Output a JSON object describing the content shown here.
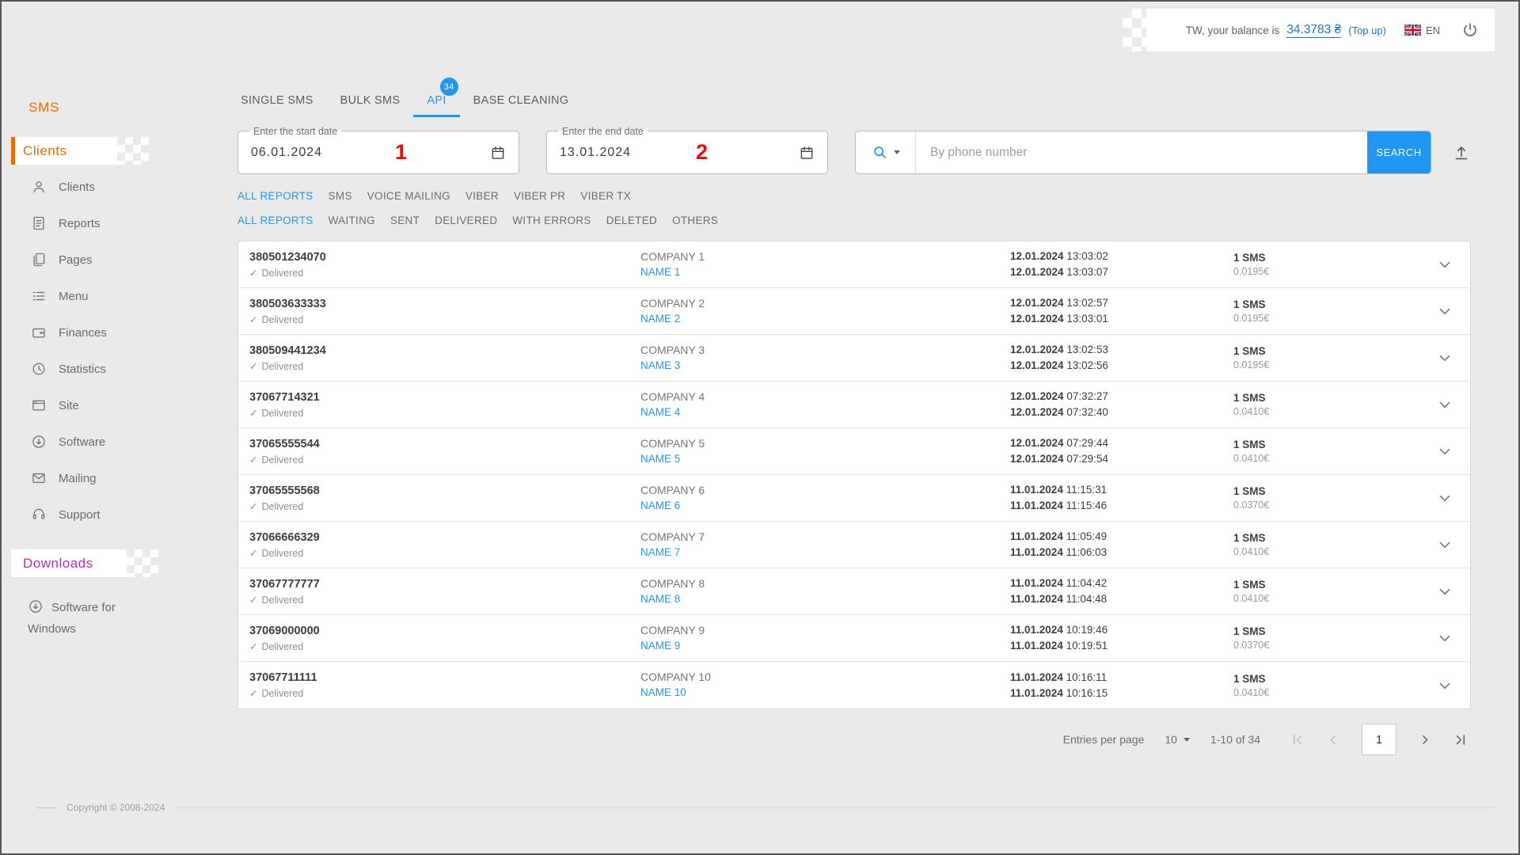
{
  "topbar": {
    "balance_prefix": "TW, your balance is",
    "balance_amount": "34.3783 ₴",
    "topup": "(Top up)",
    "language": "EN"
  },
  "sidebar": {
    "sms_header": "SMS",
    "clients_header": "Clients",
    "downloads_header": "Downloads",
    "items": [
      {
        "label": "Clients",
        "icon": "person-icon"
      },
      {
        "label": "Reports",
        "icon": "report-icon"
      },
      {
        "label": "Pages",
        "icon": "pages-icon"
      },
      {
        "label": "Menu",
        "icon": "menu-icon"
      },
      {
        "label": "Finances",
        "icon": "wallet-icon"
      },
      {
        "label": "Statistics",
        "icon": "clock-icon"
      },
      {
        "label": "Site",
        "icon": "browser-icon"
      },
      {
        "label": "Software",
        "icon": "download-icon"
      },
      {
        "label": "Mailing",
        "icon": "mail-icon"
      },
      {
        "label": "Support",
        "icon": "headset-icon"
      }
    ],
    "software_for_windows": "Software for Windows",
    "copyright": "Copyright © 2008-2024"
  },
  "tabs": [
    {
      "label": "SINGLE SMS"
    },
    {
      "label": "BULK SMS"
    },
    {
      "label": "API",
      "badge": "34",
      "active": true
    },
    {
      "label": "BASE CLEANING"
    }
  ],
  "filters": {
    "start_date": {
      "label": "Enter the start date",
      "value": "06.01.2024",
      "annotation": "1"
    },
    "end_date": {
      "label": "Enter the end date",
      "value": "13.01.2024",
      "annotation": "2"
    },
    "search_placeholder": "By phone number",
    "search_button": "SEARCH"
  },
  "report_type_filters": [
    "ALL REPORTS",
    "SMS",
    "VOICE MAILING",
    "VIBER",
    "VIBER PR",
    "VIBER TX"
  ],
  "status_filters": [
    "ALL REPORTS",
    "WAITING",
    "SENT",
    "DELIVERED",
    "WITH ERRORS",
    "DELETED",
    "OTHERS"
  ],
  "table": {
    "check_glyph": "✓",
    "rows": [
      {
        "phone": "380501234070",
        "status": "Delivered",
        "company": "COMPANY 1",
        "name": "NAME 1",
        "date_sent": "12.01.2024",
        "time_sent": "13:03:02",
        "date_delivered": "12.01.2024",
        "time_delivered": "13:03:07",
        "sms": "1 SMS",
        "price": "0.0195€"
      },
      {
        "phone": "380503633333",
        "status": "Delivered",
        "company": "COMPANY 2",
        "name": "NAME 2",
        "date_sent": "12.01.2024",
        "time_sent": "13:02:57",
        "date_delivered": "12.01.2024",
        "time_delivered": "13:03:01",
        "sms": "1 SMS",
        "price": "0.0195€"
      },
      {
        "phone": "380509441234",
        "status": "Delivered",
        "company": "COMPANY 3",
        "name": "NAME 3",
        "date_sent": "12.01.2024",
        "time_sent": "13:02:53",
        "date_delivered": "12.01.2024",
        "time_delivered": "13:02:56",
        "sms": "1 SMS",
        "price": "0.0195€"
      },
      {
        "phone": "37067714321",
        "status": "Delivered",
        "company": "COMPANY 4",
        "name": "NAME 4",
        "date_sent": "12.01.2024",
        "time_sent": "07:32:27",
        "date_delivered": "12.01.2024",
        "time_delivered": "07:32:40",
        "sms": "1 SMS",
        "price": "0.0410€"
      },
      {
        "phone": "37065555544",
        "status": "Delivered",
        "company": "COMPANY 5",
        "name": "NAME 5",
        "date_sent": "12.01.2024",
        "time_sent": "07:29:44",
        "date_delivered": "12.01.2024",
        "time_delivered": "07:29:54",
        "sms": "1 SMS",
        "price": "0.0410€"
      },
      {
        "phone": "37065555568",
        "status": "Delivered",
        "company": "COMPANY 6",
        "name": "NAME 6",
        "date_sent": "11.01.2024",
        "time_sent": "11:15:31",
        "date_delivered": "11.01.2024",
        "time_delivered": "11:15:46",
        "sms": "1 SMS",
        "price": "0.0370€"
      },
      {
        "phone": "37066666329",
        "status": "Delivered",
        "company": "COMPANY 7",
        "name": "NAME 7",
        "date_sent": "11.01.2024",
        "time_sent": "11:05:49",
        "date_delivered": "11.01.2024",
        "time_delivered": "11:06:03",
        "sms": "1 SMS",
        "price": "0.0410€"
      },
      {
        "phone": "37067777777",
        "status": "Delivered",
        "company": "COMPANY 8",
        "name": "NAME 8",
        "date_sent": "11.01.2024",
        "time_sent": "11:04:42",
        "date_delivered": "11.01.2024",
        "time_delivered": "11:04:48",
        "sms": "1 SMS",
        "price": "0.0410€"
      },
      {
        "phone": "37069000000",
        "status": "Delivered",
        "company": "COMPANY 9",
        "name": "NAME 9",
        "date_sent": "11.01.2024",
        "time_sent": "10:19:46",
        "date_delivered": "11.01.2024",
        "time_delivered": "10:19:51",
        "sms": "1 SMS",
        "price": "0.0370€"
      },
      {
        "phone": "37067711111",
        "status": "Delivered",
        "company": "COMPANY 10",
        "name": "NAME 10",
        "date_sent": "11.01.2024",
        "time_sent": "10:16:11",
        "date_delivered": "11.01.2024",
        "time_delivered": "10:16:15",
        "sms": "1 SMS",
        "price": "0.0410€"
      }
    ]
  },
  "pagination": {
    "entries_per_page_label": "Entries per page",
    "entries_per_page_value": "10",
    "range_label": "1-10 of 34",
    "current_page": "1"
  },
  "colors": {
    "accent": "#2196F3",
    "orange": "#f06a00",
    "purple": "#b232b2",
    "annotation_red": "#e80c0c"
  }
}
